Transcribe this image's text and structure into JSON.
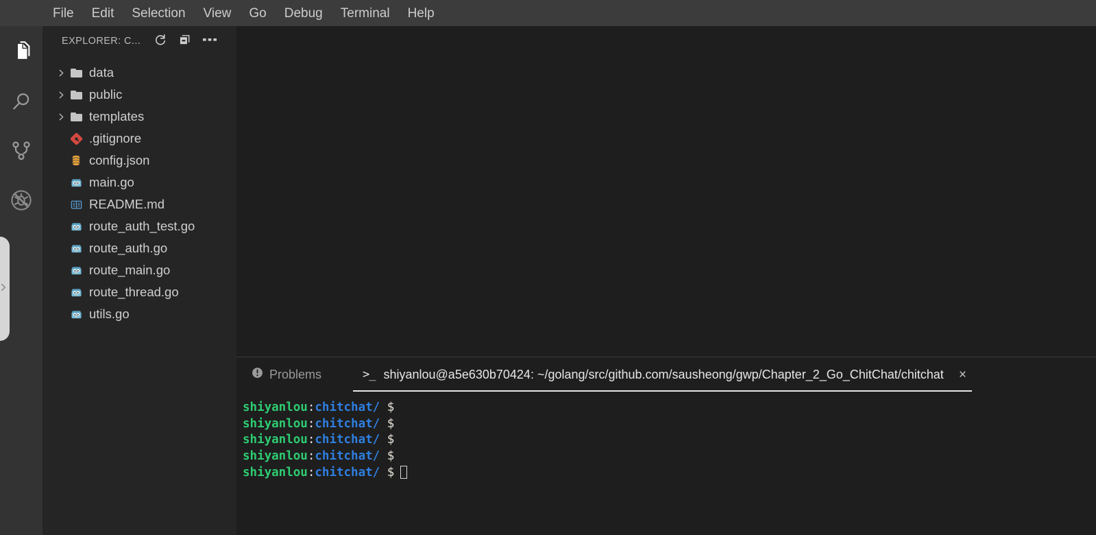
{
  "titlebar": {
    "menu": [
      {
        "label": "File",
        "name": "menu-file"
      },
      {
        "label": "Edit",
        "name": "menu-edit"
      },
      {
        "label": "Selection",
        "name": "menu-selection"
      },
      {
        "label": "View",
        "name": "menu-view"
      },
      {
        "label": "Go",
        "name": "menu-go"
      },
      {
        "label": "Debug",
        "name": "menu-debug"
      },
      {
        "label": "Terminal",
        "name": "menu-terminal"
      },
      {
        "label": "Help",
        "name": "menu-help"
      }
    ]
  },
  "activitybar": {
    "items": [
      {
        "icon": "files-explorer-icon",
        "active": true
      },
      {
        "icon": "search-icon",
        "active": false
      },
      {
        "icon": "source-control-branch-icon",
        "active": false
      },
      {
        "icon": "debug-disabled-icon",
        "active": false
      }
    ]
  },
  "sidebar": {
    "title": "EXPLORER: C...",
    "actions": [
      {
        "icon": "refresh-icon",
        "title": "Refresh Explorer"
      },
      {
        "icon": "collapse-all-icon",
        "title": "Collapse Folders in Explorer"
      },
      {
        "icon": "more-actions-icon",
        "title": "Views and More Actions..."
      }
    ],
    "tree": [
      {
        "label": "data",
        "type": "folder",
        "icon": "folder-icon",
        "expanded": false
      },
      {
        "label": "public",
        "type": "folder",
        "icon": "folder-icon",
        "expanded": false
      },
      {
        "label": "templates",
        "type": "folder",
        "icon": "folder-icon",
        "expanded": false
      },
      {
        "label": ".gitignore",
        "type": "file",
        "icon": "git-file-icon"
      },
      {
        "label": "config.json",
        "type": "file",
        "icon": "json-database-icon"
      },
      {
        "label": "main.go",
        "type": "file",
        "icon": "go-gopher-icon"
      },
      {
        "label": "README.md",
        "type": "file",
        "icon": "markdown-book-icon"
      },
      {
        "label": "route_auth_test.go",
        "type": "file",
        "icon": "go-gopher-icon"
      },
      {
        "label": "route_auth.go",
        "type": "file",
        "icon": "go-gopher-icon"
      },
      {
        "label": "route_main.go",
        "type": "file",
        "icon": "go-gopher-icon"
      },
      {
        "label": "route_thread.go",
        "type": "file",
        "icon": "go-gopher-icon"
      },
      {
        "label": "utils.go",
        "type": "file",
        "icon": "go-gopher-icon"
      }
    ]
  },
  "panel": {
    "problems_tab": {
      "label": "Problems",
      "icon": "warning-circle-icon"
    },
    "terminal_tab": {
      "label": "shiyanlou@a5e630b70424: ~/golang/src/github.com/sausheong/gwp/Chapter_2_Go_ChitChat/chitchat",
      "icon": "terminal-prompt-icon",
      "close": "×",
      "active": true
    },
    "terminal": {
      "prompt_user": "shiyanlou",
      "prompt_sep": ":",
      "prompt_path": "chitchat/",
      "prompt_symbol": "$",
      "lines": [
        {
          "cursor": false
        },
        {
          "cursor": false
        },
        {
          "cursor": false
        },
        {
          "cursor": false
        },
        {
          "cursor": true
        }
      ]
    }
  },
  "colors": {
    "titlebar_bg": "#3c3c3c",
    "activitybar_bg": "#333333",
    "sidebar_bg": "#252526",
    "editor_bg": "#1e1e1e",
    "terminal_green": "#2ecc71",
    "terminal_blue": "#2f7fe0",
    "accent_white": "#e7e7e7"
  }
}
